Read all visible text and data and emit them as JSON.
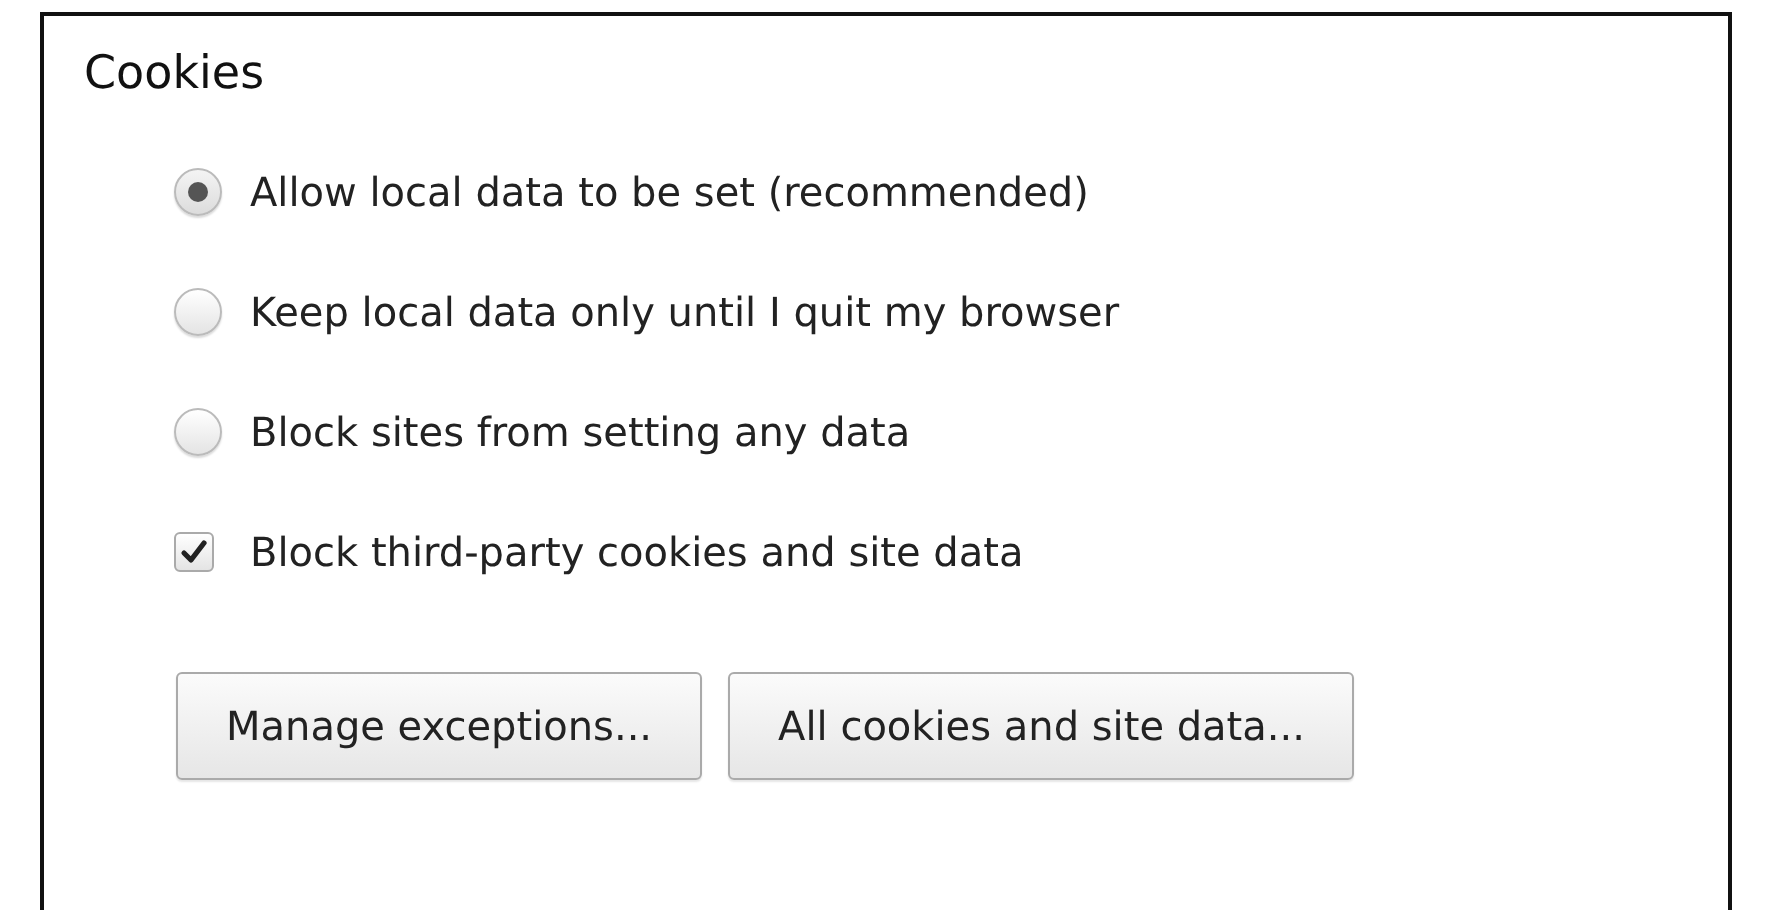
{
  "section": {
    "title": "Cookies"
  },
  "options": [
    {
      "kind": "radio",
      "label": "Allow local data to be set (recommended)",
      "selected": true
    },
    {
      "kind": "radio",
      "label": "Keep local data only until I quit my browser",
      "selected": false
    },
    {
      "kind": "radio",
      "label": "Block sites from setting any data",
      "selected": false
    },
    {
      "kind": "checkbox",
      "label": "Block third-party cookies and site data",
      "checked": true
    }
  ],
  "buttons": [
    "Manage exceptions...",
    "All cookies and site data..."
  ]
}
